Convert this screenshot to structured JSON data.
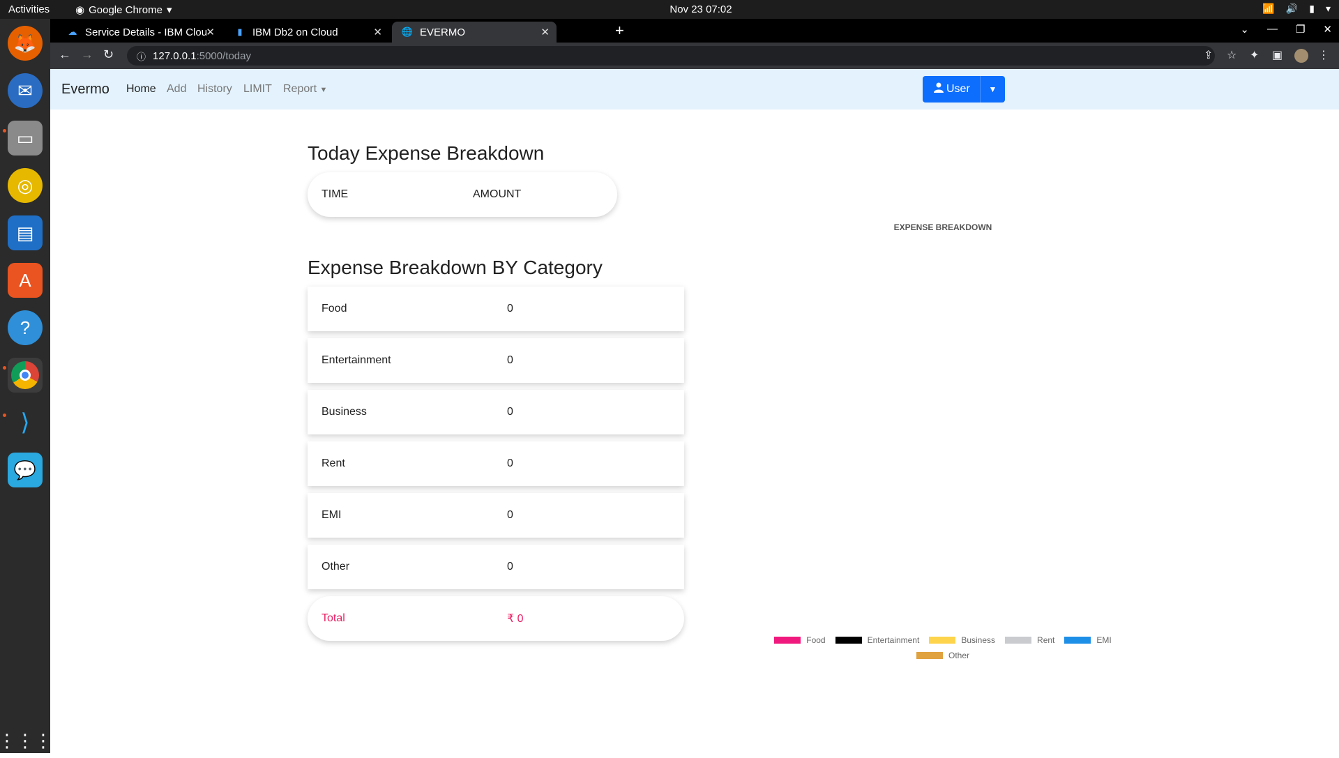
{
  "system": {
    "activities": "Activities",
    "app_name": "Google Chrome",
    "clock": "Nov 23  07:02"
  },
  "browser": {
    "tabs": [
      {
        "title": "Service Details - IBM Clou",
        "favicon": "ibm-cloud-icon"
      },
      {
        "title": "IBM Db2 on Cloud",
        "favicon": "db2-icon"
      },
      {
        "title": "EVERMO",
        "favicon": "globe-icon",
        "active": true
      }
    ],
    "url_host": "127.0.0.1",
    "url_path": ":5000/today"
  },
  "navbar": {
    "brand": "Evermo",
    "links": [
      "Home",
      "Add",
      "History",
      "LIMIT",
      "Report"
    ],
    "user_button": "User"
  },
  "today": {
    "heading": "Today Expense Breakdown",
    "col_time": "TIME",
    "col_amount": "AMOUNT"
  },
  "category": {
    "heading": "Expense Breakdown BY Category",
    "rows": [
      {
        "label": "Food",
        "value": "0"
      },
      {
        "label": "Entertainment",
        "value": "0"
      },
      {
        "label": "Business",
        "value": "0"
      },
      {
        "label": "Rent",
        "value": "0"
      },
      {
        "label": "EMI",
        "value": "0"
      },
      {
        "label": "Other",
        "value": "0"
      }
    ],
    "total_label": "Total",
    "total_value": "₹ 0"
  },
  "chart_data": {
    "type": "pie",
    "title": "EXPENSE BREAKDOWN",
    "categories": [
      "Food",
      "Entertainment",
      "Business",
      "Rent",
      "EMI",
      "Other"
    ],
    "values": [
      0,
      0,
      0,
      0,
      0,
      0
    ],
    "colors": [
      "#f0197d",
      "#000000",
      "#fdd44c",
      "#c9cbcf",
      "#1e8fe6",
      "#e0a13f"
    ],
    "legend": "bottom"
  },
  "colors": {
    "accent": "#0d6efd",
    "navbar_bg": "#e3f2fd",
    "total_text": "#e91e63"
  }
}
